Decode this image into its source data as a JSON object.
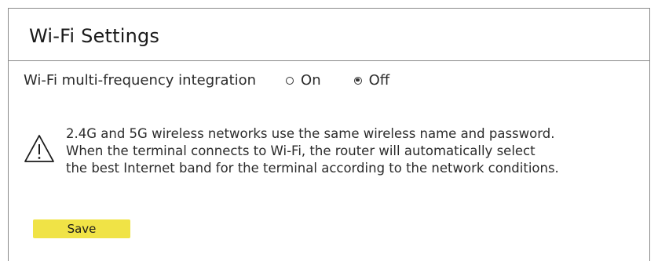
{
  "panel": {
    "title": "Wi-Fi Settings"
  },
  "integration": {
    "label": "Wi-Fi multi-frequency integration",
    "options": [
      {
        "label": "On",
        "selected": false
      },
      {
        "label": "Off",
        "selected": true
      }
    ]
  },
  "note": {
    "icon": "warning-triangle-icon",
    "lines": [
      "2.4G and 5G wireless networks use the same wireless name and password.",
      "When the terminal connects to Wi-Fi, the router will automatically select",
      "the best Internet band for the terminal according to the network conditions."
    ]
  },
  "actions": {
    "save_label": "Save"
  },
  "colors": {
    "save_button": "#f0e346",
    "border": "#8a8a8a"
  }
}
